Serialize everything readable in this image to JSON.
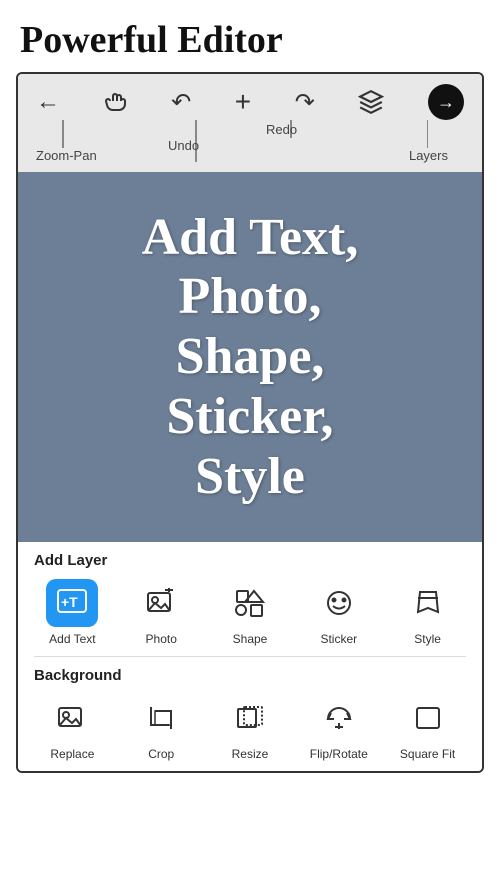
{
  "header": {
    "title": "Powerful Editor"
  },
  "toolbar": {
    "icons": [
      {
        "name": "back-arrow",
        "symbol": "←",
        "label": ""
      },
      {
        "name": "zoom-pan",
        "symbol": "☜",
        "label": "Zoom-Pan"
      },
      {
        "name": "undo",
        "symbol": "↺",
        "label": "Undo"
      },
      {
        "name": "add",
        "symbol": "+",
        "label": ""
      },
      {
        "name": "redo",
        "symbol": "↻",
        "label": "Redo"
      },
      {
        "name": "layers",
        "symbol": "◈",
        "label": "Layers"
      },
      {
        "name": "next",
        "symbol": "→",
        "label": ""
      }
    ]
  },
  "canvas": {
    "text": "Add Text,\nPhoto,\nShape,\nSticker,\nStyle"
  },
  "add_layer": {
    "section_title": "Add Layer",
    "tools": [
      {
        "name": "add-text",
        "label": "Add Text",
        "active": true
      },
      {
        "name": "photo",
        "label": "Photo",
        "active": false
      },
      {
        "name": "shape",
        "label": "Shape",
        "active": false
      },
      {
        "name": "sticker",
        "label": "Sticker",
        "active": false
      },
      {
        "name": "style",
        "label": "Style",
        "active": false
      }
    ]
  },
  "background": {
    "section_title": "Background",
    "tools": [
      {
        "name": "replace",
        "label": "Replace",
        "active": false
      },
      {
        "name": "crop",
        "label": "Crop",
        "active": false
      },
      {
        "name": "resize",
        "label": "Resize",
        "active": false
      },
      {
        "name": "flip-rotate",
        "label": "Flip/Rotate",
        "active": false
      },
      {
        "name": "square-fit",
        "label": "Square Fit",
        "active": false
      }
    ]
  }
}
